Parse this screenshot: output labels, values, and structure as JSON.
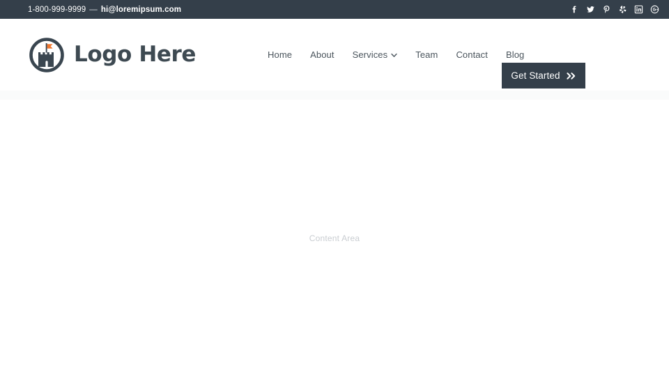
{
  "topbar": {
    "phone": "1-800-999-9999",
    "separator": "—",
    "email": "hi@loremipsum.com",
    "background_color": "#343f4a",
    "text_color": "#ffffff",
    "social": [
      {
        "name": "facebook-icon",
        "label": "Facebook"
      },
      {
        "name": "twitter-icon",
        "label": "Twitter"
      },
      {
        "name": "pinterest-icon",
        "label": "Pinterest"
      },
      {
        "name": "yelp-icon",
        "label": "Yelp"
      },
      {
        "name": "linkedin-icon",
        "label": "LinkedIn"
      },
      {
        "name": "googleplus-icon",
        "label": "Google Plus"
      }
    ]
  },
  "header": {
    "logo": {
      "text": "Logo Here",
      "mark": "castle-flag-icon",
      "mark_color": "#3a4650",
      "flag_color": "#f07830",
      "text_color": "#3e4a52"
    },
    "nav": [
      {
        "label": "Home",
        "has_dropdown": false
      },
      {
        "label": "About",
        "has_dropdown": false
      },
      {
        "label": "Services",
        "has_dropdown": true
      },
      {
        "label": "Team",
        "has_dropdown": false
      },
      {
        "label": "Contact",
        "has_dropdown": false
      },
      {
        "label": "Blog",
        "has_dropdown": false
      }
    ],
    "cta": {
      "label": "Get Started",
      "icon": "double-chevron-right-icon",
      "background_color": "#343f4a",
      "text_color": "#ffffff"
    }
  },
  "main": {
    "placeholder": "Content Area",
    "placeholder_color": "#c9cdd1",
    "background_color": "#ffffff"
  }
}
